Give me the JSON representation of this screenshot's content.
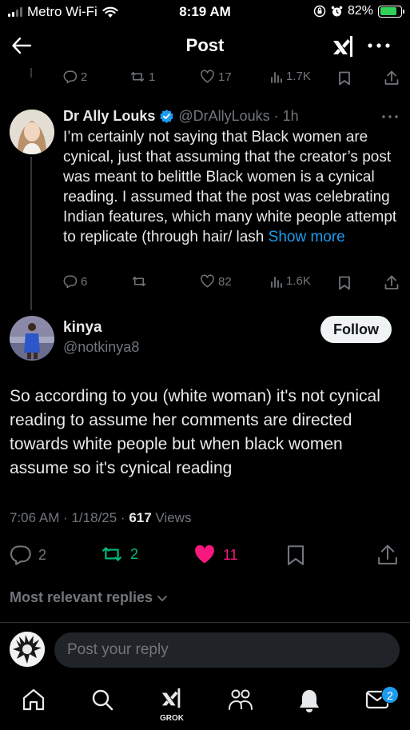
{
  "status_bar": {
    "carrier": "Metro Wi-Fi",
    "time": "8:19 AM",
    "battery": "82%",
    "battery_level": 0.82
  },
  "header": {
    "title": "Post"
  },
  "parent_actions": {
    "replies": "2",
    "reposts": "1",
    "likes": "17",
    "views": "1.7K"
  },
  "reply": {
    "name": "Dr Ally Louks",
    "handle": "@DrAllyLouks",
    "time": "· 1h",
    "text": "I’m certainly not saying that Black women are cynical, just that assuming that the creator’s post was meant to belittle Black women is a cynical reading. I assumed that the post was celebrating Indian features, which many white people attempt to replicate (through hair/ lash",
    "show_more": "Show more",
    "replies": "6",
    "likes": "82",
    "views": "1.6K"
  },
  "main_post": {
    "name": "kinya",
    "handle": "@notkinya8",
    "follow_label": "Follow",
    "text": "So according to you (white woman) it's not cynical reading to assume her  comments are directed towards white people but when black women assume so it's cynical reading",
    "time": "7:06 AM · 1/18/25 · ",
    "views_count": "617",
    "views_label": " Views",
    "replies": "2",
    "reposts": "2",
    "likes": "11"
  },
  "replies_sort": "Most relevant replies",
  "composer": {
    "placeholder": "Post your reply"
  },
  "tabbar": {
    "grok_label": "GROK",
    "messages_badge": "2"
  },
  "colors": {
    "accent": "#1d9bf0",
    "like": "#f91880",
    "repost": "#00ba7c",
    "muted": "#71767b"
  }
}
